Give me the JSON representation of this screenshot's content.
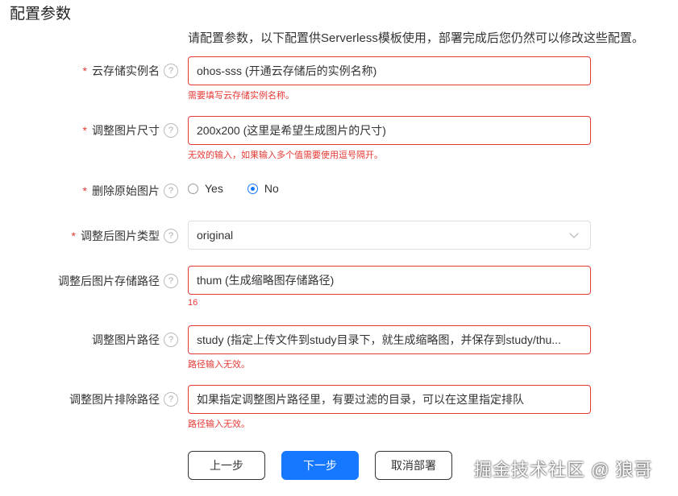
{
  "page": {
    "title": "配置参数",
    "description": "请配置参数，以下配置供Serverless模板使用，部署完成后您仍然可以修改这些配置。"
  },
  "form": {
    "instance_name": {
      "label": "云存储实例名",
      "required": true,
      "placeholder": "ohos-sss (开通云存储后的实例名称)",
      "error": "需要填写云存储实例名称。"
    },
    "image_size": {
      "label": "调整图片尺寸",
      "required": true,
      "placeholder": "200x200 (这里是希望生成图片的尺寸)",
      "error": "无效的输入，如果输入多个值需要使用逗号隔开。"
    },
    "delete_original": {
      "label": "删除原始图片",
      "required": true,
      "options": [
        "Yes",
        "No"
      ],
      "selected": "No"
    },
    "output_type": {
      "label": "调整后图片类型",
      "required": true,
      "value": "original"
    },
    "output_path": {
      "label": "调整后图片存储路径",
      "required": false,
      "placeholder": "thum (生成缩略图存储路径)",
      "error": "16"
    },
    "image_path": {
      "label": "调整图片路径",
      "required": false,
      "placeholder": "study (指定上传文件到study目录下，就生成缩略图，并保存到study/thu...",
      "error": "路径输入无效。"
    },
    "exclude_path": {
      "label": "调整图片排除路径",
      "required": false,
      "placeholder": "如果指定调整图片路径里，有要过滤的目录，可以在这里指定排队",
      "error": "路径输入无效。"
    }
  },
  "buttons": {
    "prev": "上一步",
    "next": "下一步",
    "cancel": "取消部署"
  },
  "watermark": "掘金技术社区 @ 狼哥",
  "colors": {
    "accent": "#1677ff",
    "error": "#e53935"
  },
  "icons": {
    "help": "question-circle-icon",
    "dropdown": "chevron-down-icon"
  }
}
